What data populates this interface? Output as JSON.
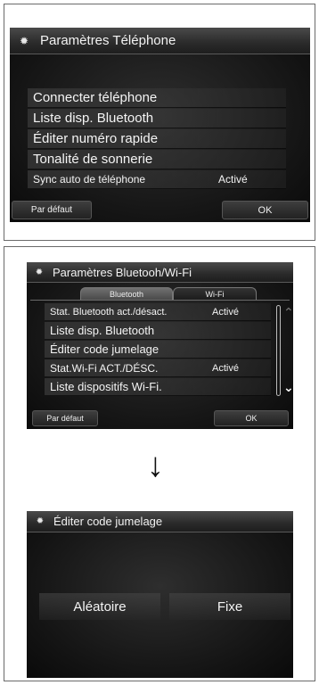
{
  "phone_settings": {
    "title": "Paramètres Téléphone",
    "items": [
      {
        "label": "Connecter téléphone",
        "value": ""
      },
      {
        "label": "Liste disp. Bluetooth",
        "value": ""
      },
      {
        "label": "Éditer numéro rapide",
        "value": ""
      },
      {
        "label": "Tonalité de sonnerie",
        "value": ""
      },
      {
        "label": "Sync auto de téléphone",
        "value": "Activé"
      }
    ],
    "default_button": "Par défaut",
    "ok_button": "OK"
  },
  "bt_settings": {
    "title": "Paramètres Bluetooh/Wi-Fi",
    "tabs": [
      "Bluetooth",
      "Wi-Fi"
    ],
    "items": [
      {
        "label": "Stat. Bluetooth act./désact.",
        "value": "Activé"
      },
      {
        "label": "Liste disp. Bluetooth",
        "value": ""
      },
      {
        "label": "Éditer code jumelage",
        "value": ""
      },
      {
        "label": "Stat.Wi-Fi ACT./DÉSC.",
        "value": "Activé"
      },
      {
        "label": "Liste dispositifs Wi-Fi.",
        "value": ""
      }
    ],
    "default_button": "Par défaut",
    "ok_button": "OK"
  },
  "arrow": "↓",
  "pairing": {
    "title": "Éditer code jumelage",
    "options": [
      "Aléatoire",
      "Fixe"
    ]
  },
  "icons": {
    "gear": "✹",
    "scroll_up": "⌃",
    "scroll_down": "⌄"
  }
}
